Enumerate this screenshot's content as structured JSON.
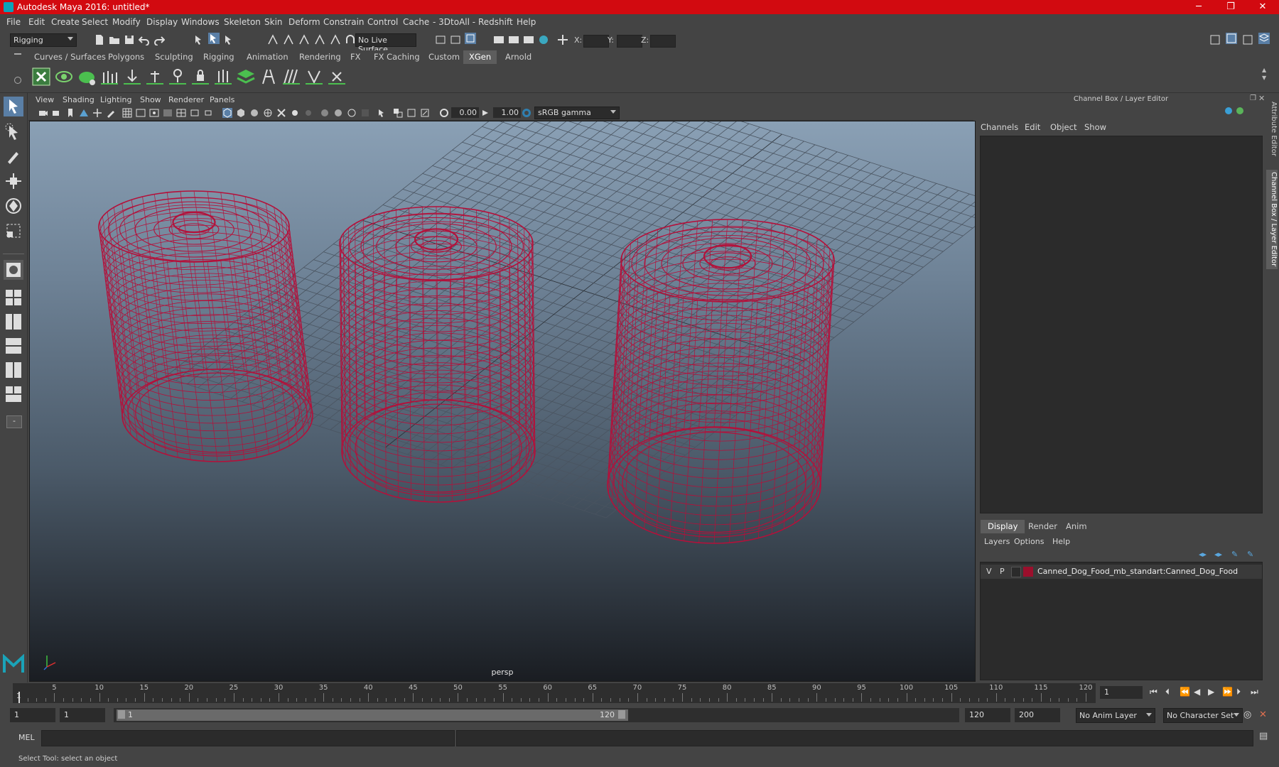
{
  "window": {
    "title": "Autodesk Maya 2016: untitled*",
    "minimize": "─",
    "maximize": "❐",
    "close": "✕"
  },
  "menubar": [
    "File",
    "Edit",
    "Create",
    "Select",
    "Modify",
    "Display",
    "Windows",
    "Skeleton",
    "Skin",
    "Deform",
    "Constrain",
    "Control",
    "Cache",
    "- 3DtoAll -",
    "Redshift",
    "Help"
  ],
  "statusline": {
    "menuset": "Rigging",
    "live_surface": "No Live Surface",
    "x_label": "X:",
    "y_label": "Y:",
    "z_label": "Z:"
  },
  "shelf_tabs": [
    "Curves / Surfaces",
    "Polygons",
    "Sculpting",
    "Rigging",
    "Animation",
    "Rendering",
    "FX",
    "FX Caching",
    "Custom",
    "XGen",
    "Arnold"
  ],
  "active_shelf": "XGen",
  "panel": {
    "menus": [
      "View",
      "Shading",
      "Lighting",
      "Show",
      "Renderer",
      "Panels"
    ],
    "exposure": "0.00",
    "gamma": "1.00",
    "color_space": "sRGB gamma",
    "camera_label": "persp"
  },
  "channel_box": {
    "title": "Channel Box / Layer Editor",
    "menus": [
      "Channels",
      "Edit",
      "Object",
      "Show"
    ]
  },
  "layer_editor": {
    "tabs": [
      "Display",
      "Render",
      "Anim"
    ],
    "active_tab": "Display",
    "menus": [
      "Layers",
      "Options",
      "Help"
    ],
    "layers": [
      {
        "visible": "V",
        "playback": "P",
        "color": "#9b0f2c",
        "name": "Canned_Dog_Food_mb_standart:Canned_Dog_Food"
      }
    ]
  },
  "side_tabs": [
    "Attribute Editor",
    "Channel Box / Layer Editor"
  ],
  "timeline": {
    "ticks": [
      5,
      10,
      15,
      20,
      25,
      30,
      35,
      40,
      45,
      50,
      55,
      60,
      65,
      70,
      75,
      80,
      85,
      90,
      95,
      100,
      105,
      110,
      115,
      120
    ],
    "start": 1,
    "end": 120,
    "current_frame_marker": "1",
    "current_frame": "1"
  },
  "range": {
    "start": "1",
    "start_inner": "1",
    "slider_start": "1",
    "slider_end": "120",
    "end_inner": "120",
    "end": "200",
    "anim_layer": "No Anim Layer",
    "character_set": "No Character Set"
  },
  "command_line": {
    "label": "MEL"
  },
  "help_line": {
    "text": "Select Tool: select an object"
  },
  "colors": {
    "wireframe": "#b4103a",
    "title_bar": "#d20a10",
    "active_tab": "#5d5d5d"
  }
}
